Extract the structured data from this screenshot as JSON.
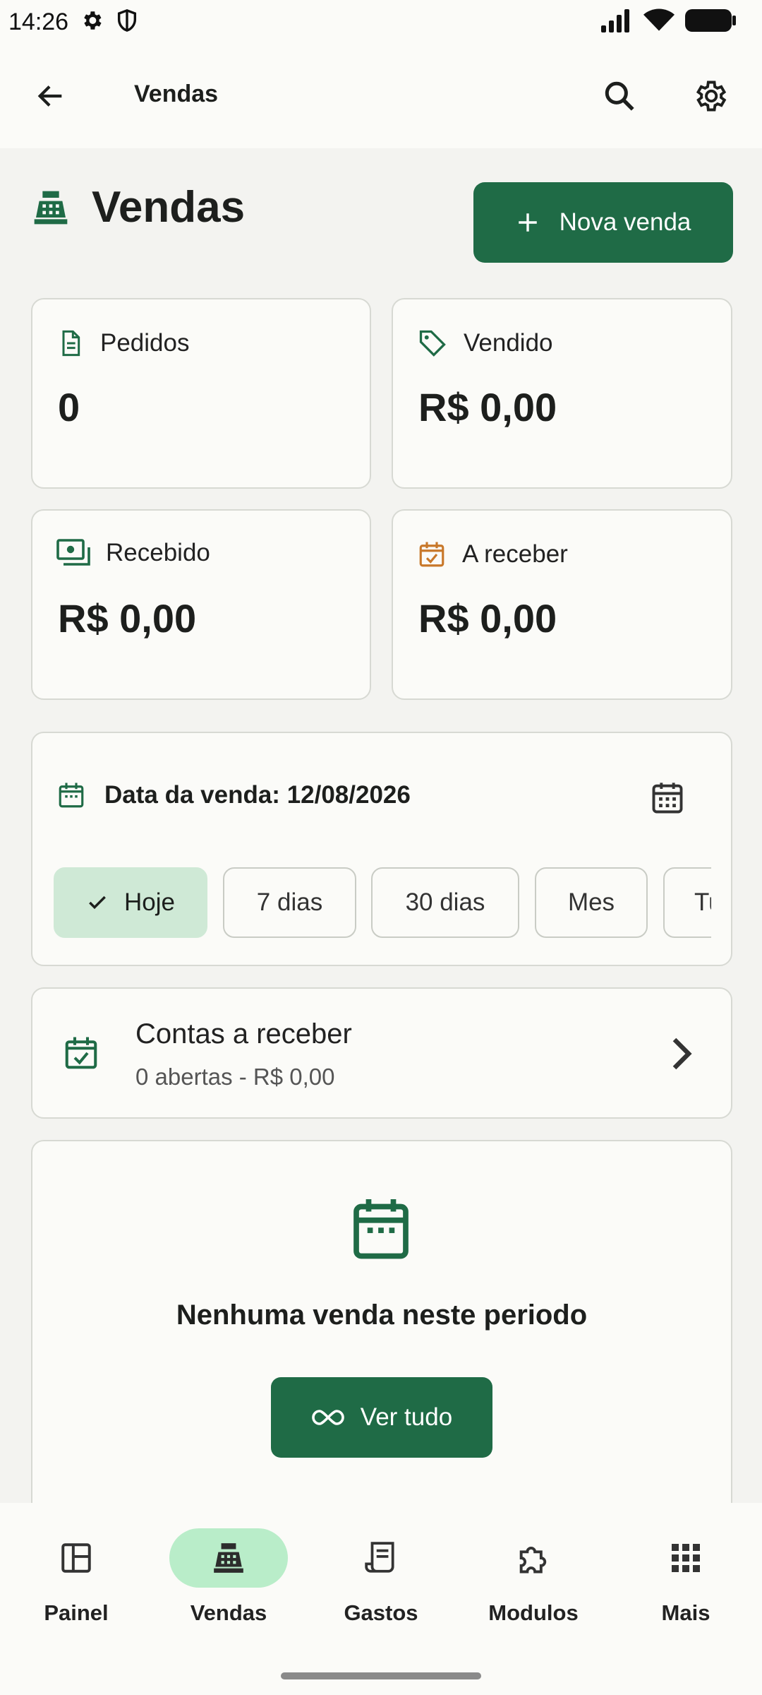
{
  "status": {
    "time": "14:26"
  },
  "appbar": {
    "title": "Vendas"
  },
  "page": {
    "title": "Vendas",
    "new_sale_label": "Nova venda"
  },
  "stats": [
    {
      "label": "Pedidos",
      "value": "0"
    },
    {
      "label": "Vendido",
      "value": "R$ 0,00"
    },
    {
      "label": "Recebido",
      "value": "R$ 0,00"
    },
    {
      "label": "A receber",
      "value": "R$ 0,00"
    }
  ],
  "filter": {
    "date_label": "Data da venda: 12/08/2026",
    "chips": [
      "Hoje",
      "7 dias",
      "30 dias",
      "Mes",
      "Tudo"
    ],
    "active_chip": "Hoje"
  },
  "contas": {
    "title": "Contas a receber",
    "subtitle": "0 abertas - R$ 0,00"
  },
  "empty": {
    "message": "Nenhuma venda neste periodo",
    "button_label": "Ver tudo"
  },
  "nav": {
    "items": [
      "Painel",
      "Vendas",
      "Gastos",
      "Modulos",
      "Mais"
    ],
    "active": "Vendas"
  },
  "colors": {
    "primary": "#1f6b46",
    "active_pill": "#b9edc9",
    "chip_active": "#cfe9d6",
    "accent_orange": "#c8782a"
  }
}
